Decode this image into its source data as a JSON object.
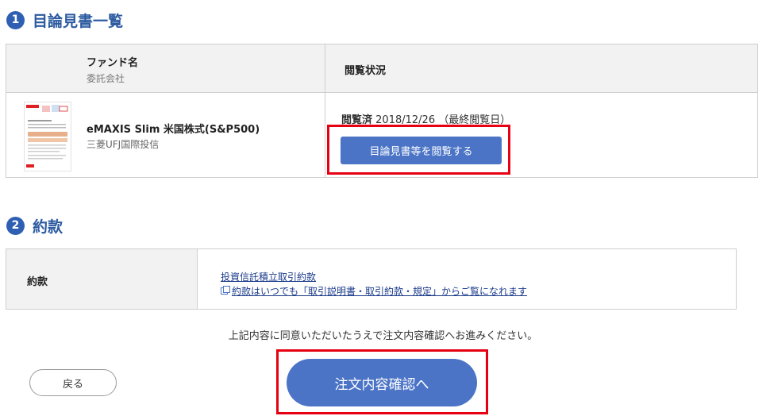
{
  "section1": {
    "number": "1",
    "title": "目論見書一覧"
  },
  "prospectus_table": {
    "header_fund": "ファンド名",
    "header_company": "委託会社",
    "header_status": "閲覧状況",
    "row": {
      "fund_name": "eMAXIS Slim 米国株式(S&P500)",
      "company": "三菱UFJ国際投信",
      "status_label": "閲覧済",
      "status_date": "2018/12/26",
      "status_note": "（最終閲覧日）",
      "view_button": "目論見書等を閲覧する"
    }
  },
  "section2": {
    "number": "2",
    "title": "約款"
  },
  "terms_table": {
    "label": "約款",
    "link_terms": "投資信託積立取引約款",
    "link_docs": "約款はいつでも「取引説明書・取引約款・規定」からご覧になれます"
  },
  "agree_text": "上記内容に同意いただいたうえで注文内容確認へお進みください。",
  "buttons": {
    "back": "戻る",
    "confirm": "注文内容確認へ"
  },
  "colors": {
    "accent": "#4b74c6",
    "highlight": "#e60012",
    "heading": "#2c5aa0"
  }
}
